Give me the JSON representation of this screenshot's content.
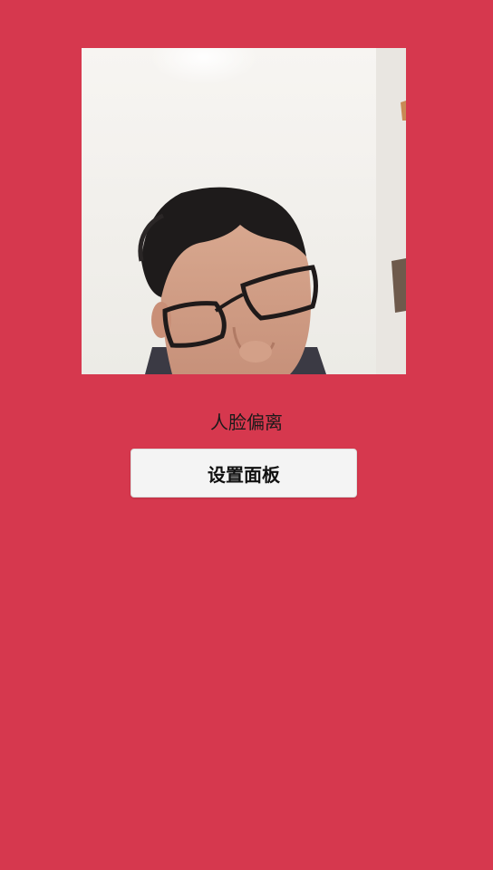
{
  "camera": {
    "feed_icon": "camera-preview"
  },
  "status": {
    "text": "人脸偏离"
  },
  "settings": {
    "label": "设置面板"
  },
  "colors": {
    "background": "#d6384e",
    "button_bg": "#f4f4f4"
  }
}
